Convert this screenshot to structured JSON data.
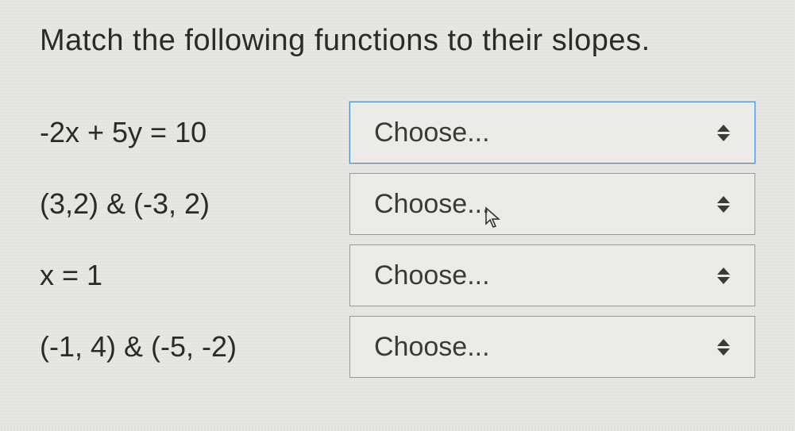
{
  "question": "Match the following functions to their slopes.",
  "placeholder": "Choose...",
  "rows": [
    {
      "label": "-2x + 5y = 10",
      "focused": true
    },
    {
      "label": "(3,2) & (-3, 2)",
      "focused": false
    },
    {
      "label": "x = 1",
      "focused": false
    },
    {
      "label": "(-1, 4) & (-5, -2)",
      "focused": false
    }
  ]
}
